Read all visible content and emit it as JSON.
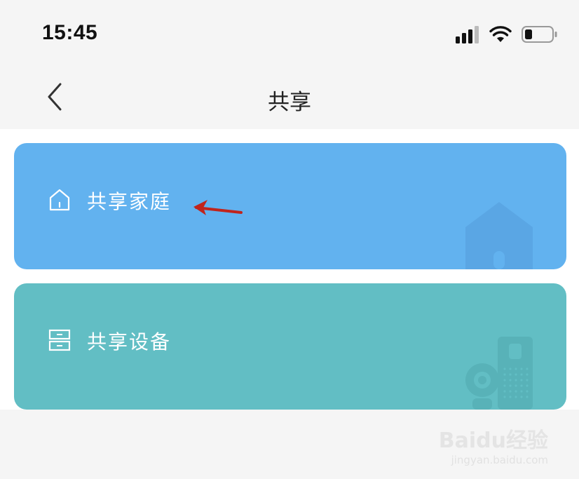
{
  "status_bar": {
    "time": "15:45",
    "icons": [
      "signal-icon",
      "wifi-icon",
      "battery-icon"
    ]
  },
  "nav": {
    "title": "共享",
    "back_icon": "chevron-left-icon"
  },
  "cards": [
    {
      "label": "共享家庭",
      "icon": "home-outline-icon",
      "color": "#62b2ef"
    },
    {
      "label": "共享设备",
      "icon": "device-outline-icon",
      "color": "#62bec4"
    }
  ],
  "annotation": {
    "arrow_color": "#c0241c"
  },
  "watermark": {
    "main": "Baidu经验",
    "sub": "jingyan.baidu.com"
  }
}
